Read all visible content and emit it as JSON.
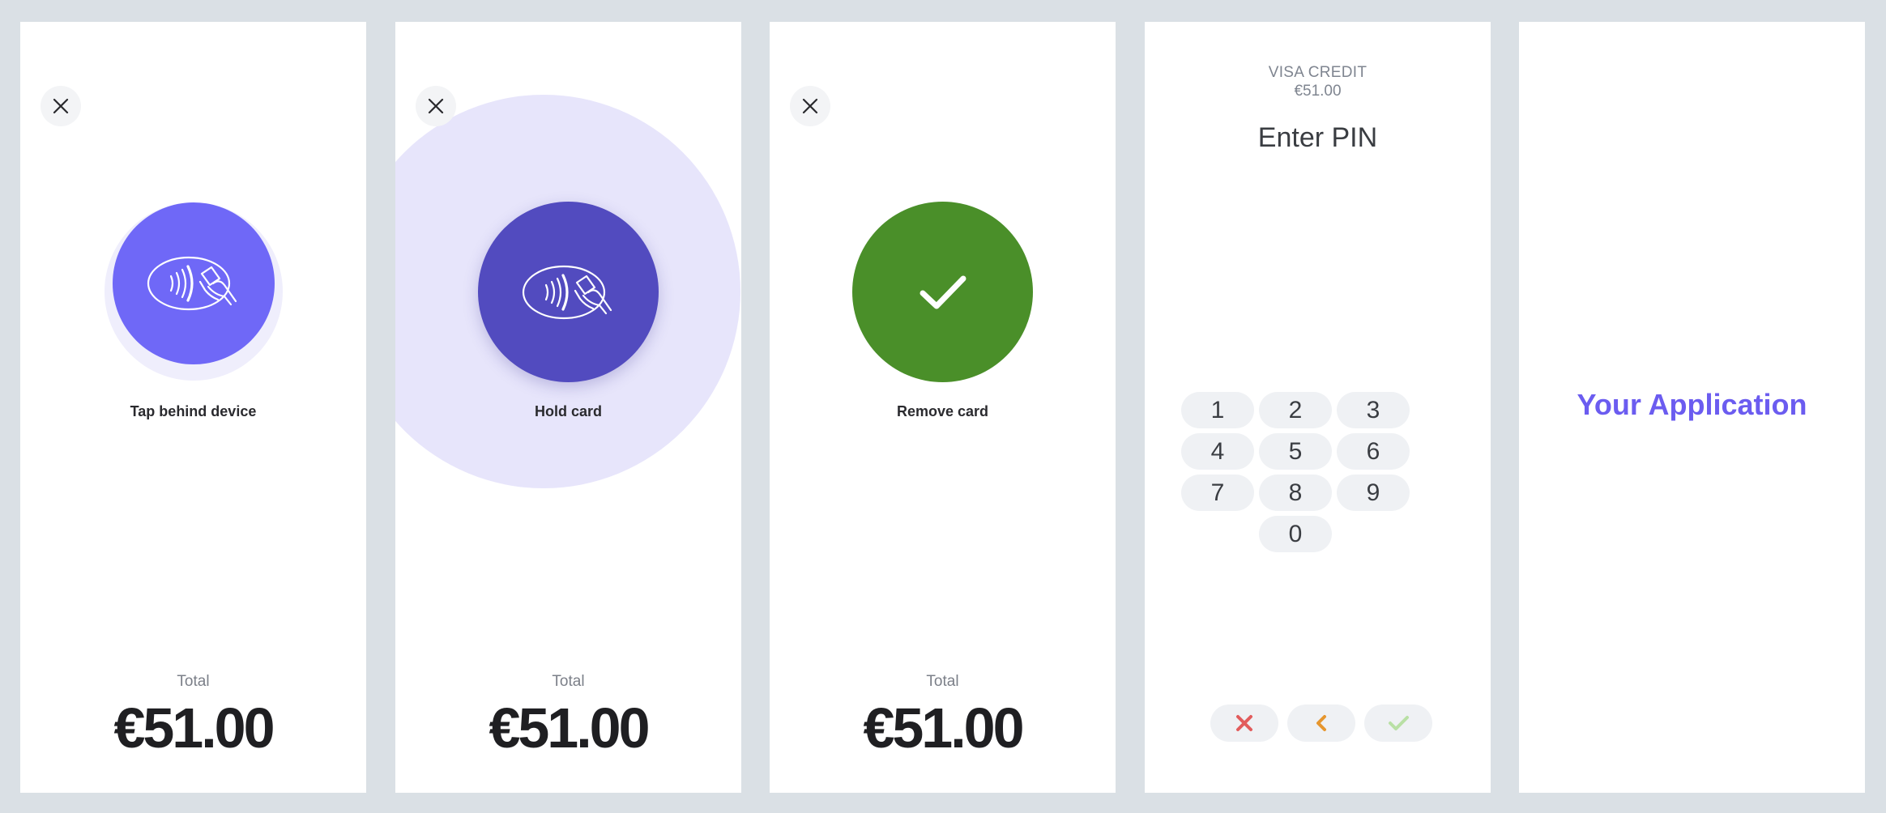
{
  "colors": {
    "background": "#dae0e5",
    "tap_circle": "#6f68f7",
    "hold_circle": "#524bbf",
    "hold_halo": "#e7e5fb",
    "success_circle": "#4a8f29",
    "app_accent": "#6b5cf0",
    "cancel": "#e25c5c",
    "back": "#e6962e",
    "confirm": "#b9e0a5"
  },
  "screens": {
    "tap": {
      "close_icon": "close-icon",
      "icon": "contactless-icon",
      "status": "Tap behind device",
      "total_label": "Total",
      "total_amount": "€51.00"
    },
    "hold": {
      "close_icon": "close-icon",
      "icon": "contactless-icon",
      "status": "Hold card",
      "total_label": "Total",
      "total_amount": "€51.00"
    },
    "remove": {
      "close_icon": "close-icon",
      "icon": "checkmark-icon",
      "status": "Remove card",
      "total_label": "Total",
      "total_amount": "€51.00"
    },
    "pin": {
      "card_brand": "VISA CREDIT",
      "amount": "€51.00",
      "title": "Enter PIN",
      "keys": [
        "1",
        "2",
        "3",
        "4",
        "5",
        "6",
        "7",
        "8",
        "9",
        "0"
      ],
      "actions": [
        "cancel-icon",
        "back-icon",
        "confirm-icon"
      ]
    },
    "app": {
      "label": "Your Application"
    }
  }
}
